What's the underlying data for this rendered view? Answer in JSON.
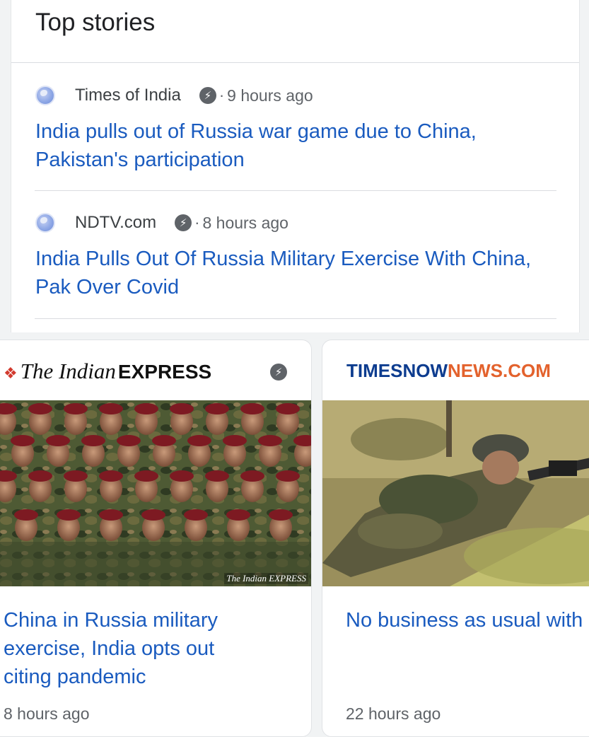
{
  "header": {
    "title": "Top stories"
  },
  "stories": [
    {
      "source": "Times of India",
      "time": "9 hours ago",
      "separator": "·",
      "amp_glyph": "⚡",
      "icon": "globe-icon",
      "headline": "India pulls out of Russia war game due to China, Pakistan's participation"
    },
    {
      "source": "NDTV.com",
      "time": "8 hours ago",
      "separator": "·",
      "amp_glyph": "⚡",
      "icon": "globe-icon",
      "headline": "India Pulls Out Of Russia Military Exercise With China, Pak Over Covid"
    }
  ],
  "cards": [
    {
      "publisher_logo": {
        "part1": "The Indian",
        "part2": "EXPRESS"
      },
      "amp_glyph": "⚡",
      "image_watermark": "The Indian EXPRESS",
      "headline": "China in Russia military\nexercise, India opts out\nciting pandemic",
      "time": "8 hours ago"
    },
    {
      "publisher_logo": {
        "part1": "TIMESNOW",
        "part2": "NEWS.COM"
      },
      "headline": "No business as usual with\nChina: India tells Russia\nwill not take part in Kavk",
      "time": "22 hours ago"
    }
  ],
  "colors": {
    "link": "#1a5bbf",
    "text_secondary": "#5f6368",
    "indian_express_red": "#d23a2e",
    "timesnow_blue": "#0d3c8f",
    "timesnow_orange": "#e3622d"
  }
}
